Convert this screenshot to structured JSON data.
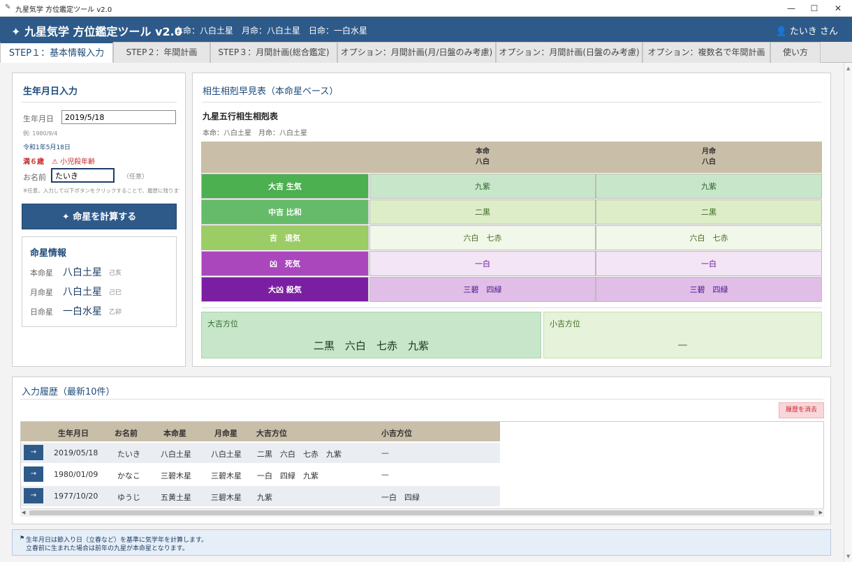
{
  "window": {
    "title": "九星気学 方位鑑定ツール v2.0",
    "minimize": "—",
    "maximize": "☐",
    "close": "✕"
  },
  "header": {
    "title": "✦ 九星気学 方位鑑定ツール v2.0",
    "info": "本命：八白土星　月命：八白土星　日命：一白水星",
    "user": "たいき さん"
  },
  "tabs": [
    "STEP１：基本情報入力",
    "STEP２：年間計画",
    "STEP３：月間計画(総合鑑定)",
    "オプション：月間計画(月/日盤のみ考慮)",
    "オプション：月間計画(日盤のみ考慮)",
    "オプション：複数名で年間計画",
    "使い方"
  ],
  "input_panel": {
    "title": "生年月日入力",
    "birth_label": "生年月日",
    "birth_value": "2019/5/18",
    "example": "例: 1980/9/4",
    "wareki": "令和1年5月18日",
    "age": "満６歳",
    "warning": "⚠ 小児殺年齢",
    "name_label": "お名前",
    "name_value": "たいき",
    "optional": "（任意）",
    "note": "※任意。入力して以下ボタンをクリックすることで、履歴に残ります。",
    "calc_button": "✦ 命星を計算する"
  },
  "star_info": {
    "title": "命星情報",
    "rows": [
      {
        "label": "本命星",
        "value": "八白土星",
        "kan": "己亥"
      },
      {
        "label": "月命星",
        "value": "八白土星",
        "kan": "己巳"
      },
      {
        "label": "日命星",
        "value": "一白水星",
        "kan": "乙卯"
      }
    ]
  },
  "compat": {
    "title": "相生相剋早見表（本命星ベース）",
    "table_title": "九星五行相生相剋表",
    "subtitle": "本命：八白土星　月命：八白土星",
    "col_headers": [
      {
        "line1": "本命",
        "line2": "八白"
      },
      {
        "line1": "月命",
        "line2": "八白"
      }
    ],
    "rows": [
      {
        "label": "大吉 生気",
        "v1": "九紫",
        "v2": "九紫",
        "label_color": "#4caf50",
        "cell_color": "#c8e6c9",
        "text_color": "#2e6b2e"
      },
      {
        "label": "中吉 比和",
        "v1": "二黒",
        "v2": "二黒",
        "label_color": "#66bb6a",
        "cell_color": "#dcedc8",
        "text_color": "#3b6b1f"
      },
      {
        "label": "吉　退気",
        "v1": "六白　七赤",
        "v2": "六白　七赤",
        "label_color": "#9ccc65",
        "cell_color": "#f1f8e9",
        "text_color": "#4a6b1f"
      },
      {
        "label": "凶　死気",
        "v1": "一白",
        "v2": "一白",
        "label_color": "#ab47bc",
        "cell_color": "#f3e5f5",
        "text_color": "#6a1b9a"
      },
      {
        "label": "大凶 殺気",
        "v1": "三碧　四緑",
        "v2": "三碧　四緑",
        "label_color": "#7b1fa2",
        "cell_color": "#e1bee7",
        "text_color": "#4a148c"
      }
    ],
    "daikichi_label": "大吉方位",
    "daikichi_value": "二黒　六白　七赤　九紫",
    "shoukichi_label": "小吉方位",
    "shoukichi_value": "—"
  },
  "history": {
    "title": "入力履歴（最新10件）",
    "clear_button": "履歴を消去",
    "headers": [
      "生年月日",
      "お名前",
      "本命星",
      "月命星",
      "大吉方位",
      "小吉方位"
    ],
    "load_icon": "→",
    "rows": [
      [
        "2019/05/18",
        "たいき",
        "八白土星",
        "八白土星",
        "二黒　六白　七赤　九紫",
        "—"
      ],
      [
        "1980/01/09",
        "かなこ",
        "三碧木星",
        "三碧木星",
        "一白　四緑　九紫",
        "—"
      ],
      [
        "1977/10/20",
        "ゆうじ",
        "五黄土星",
        "三碧木星",
        "九紫",
        "一白　四緑"
      ]
    ]
  },
  "footer_note": {
    "line1": "生年月日は節入り日（立春など）を基準に気学年を計算します。",
    "line2": "立春前に生まれた場合は前年の九星が本命星となります。"
  }
}
